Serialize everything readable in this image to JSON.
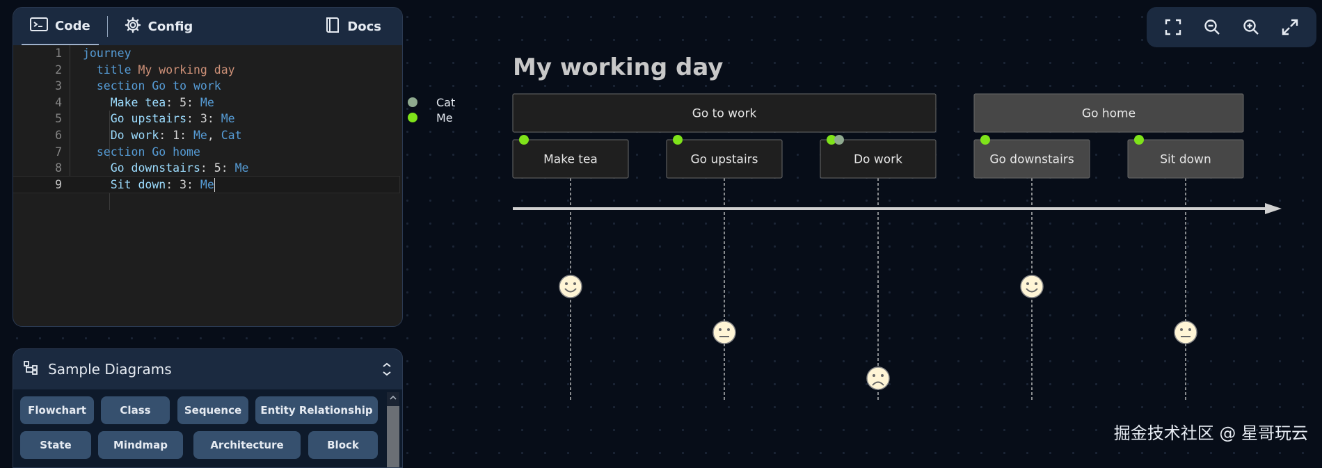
{
  "editor": {
    "tabs": {
      "code": "Code",
      "config": "Config",
      "docs": "Docs"
    },
    "line_numbers": [
      "1",
      "2",
      "3",
      "4",
      "5",
      "6",
      "7",
      "8",
      "9"
    ],
    "lines": [
      {
        "indent": "",
        "parts": [
          {
            "t": "journey",
            "c": "kw"
          }
        ]
      },
      {
        "indent": "  ",
        "parts": [
          {
            "t": "title ",
            "c": "kw"
          },
          {
            "t": "My working day",
            "c": "str"
          }
        ]
      },
      {
        "indent": "  ",
        "parts": [
          {
            "t": "section Go to work",
            "c": "kw"
          }
        ]
      },
      {
        "indent": "    ",
        "parts": [
          {
            "t": "Make tea",
            "c": "txt"
          },
          {
            "t": ": 5: ",
            "c": "plain"
          },
          {
            "t": "Me",
            "c": "kw"
          }
        ]
      },
      {
        "indent": "    ",
        "parts": [
          {
            "t": "Go upstairs",
            "c": "txt"
          },
          {
            "t": ": 3: ",
            "c": "plain"
          },
          {
            "t": "Me",
            "c": "kw"
          }
        ]
      },
      {
        "indent": "    ",
        "parts": [
          {
            "t": "Do work",
            "c": "txt"
          },
          {
            "t": ": 1: ",
            "c": "plain"
          },
          {
            "t": "Me",
            "c": "kw"
          },
          {
            "t": ", ",
            "c": "plain"
          },
          {
            "t": "Cat",
            "c": "kw"
          }
        ]
      },
      {
        "indent": "  ",
        "parts": [
          {
            "t": "section Go home",
            "c": "kw"
          }
        ]
      },
      {
        "indent": "    ",
        "parts": [
          {
            "t": "Go downstairs",
            "c": "txt"
          },
          {
            "t": ": 5: ",
            "c": "plain"
          },
          {
            "t": "Me",
            "c": "kw"
          }
        ]
      },
      {
        "indent": "    ",
        "parts": [
          {
            "t": "Sit down",
            "c": "txt"
          },
          {
            "t": ": 3: ",
            "c": "plain"
          },
          {
            "t": "Me",
            "c": "kw"
          }
        ]
      }
    ]
  },
  "samples": {
    "title": "Sample Diagrams",
    "buttons": [
      "Flowchart",
      "Class",
      "Sequence",
      "Entity Relationship",
      "State",
      "Mindmap",
      "Architecture",
      "Block"
    ]
  },
  "toolbar": [
    "fit-screen-icon",
    "zoom-out-icon",
    "zoom-in-icon",
    "fullscreen-icon"
  ],
  "journey": {
    "title": "My working day",
    "actors": [
      {
        "name": "Cat",
        "color": "#8faa8f"
      },
      {
        "name": "Me",
        "color": "#7fe31a"
      }
    ],
    "sections": [
      {
        "name": "Go to work",
        "color": "#1f1f1f"
      },
      {
        "name": "Go home",
        "color": "#474747"
      }
    ],
    "tasks": [
      {
        "name": "Make tea",
        "score": 5,
        "people": [
          "Me"
        ],
        "section": 0
      },
      {
        "name": "Go upstairs",
        "score": 3,
        "people": [
          "Me"
        ],
        "section": 0
      },
      {
        "name": "Do work",
        "score": 1,
        "people": [
          "Me",
          "Cat"
        ],
        "section": 0
      },
      {
        "name": "Go downstairs",
        "score": 5,
        "people": [
          "Me"
        ],
        "section": 1
      },
      {
        "name": "Sit down",
        "score": 3,
        "people": [
          "Me"
        ],
        "section": 1
      }
    ]
  },
  "watermark": "掘金技术社区 @ 星哥玩云"
}
